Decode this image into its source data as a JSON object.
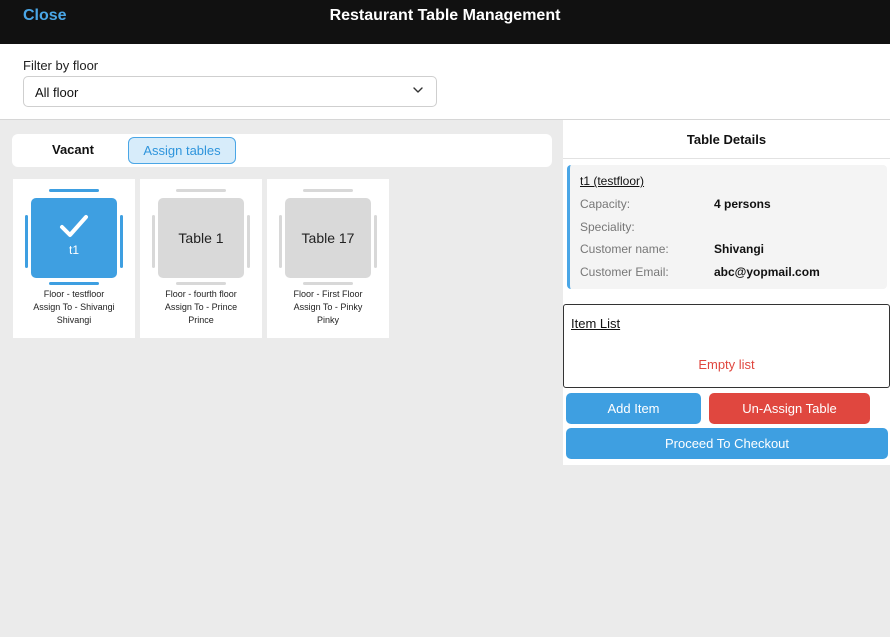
{
  "header": {
    "close_label": "Close",
    "title": "Restaurant Table Management"
  },
  "filter": {
    "label": "Filter by floor",
    "selected": "All floor"
  },
  "tabs": {
    "vacant": "Vacant",
    "assign": "Assign tables"
  },
  "tables": [
    {
      "name": "t1",
      "floor_line": "Floor - testfloor",
      "assign_line": "Assign To - Shivangi",
      "assignee_line": "Shivangi",
      "selected": true
    },
    {
      "name": "Table 1",
      "floor_line": "Floor - fourth floor",
      "assign_line": "Assign To - Prince",
      "assignee_line": "Prince",
      "selected": false
    },
    {
      "name": "Table 17",
      "floor_line": "Floor - First Floor",
      "assign_line": "Assign To - Pinky",
      "assignee_line": "Pinky",
      "selected": false
    }
  ],
  "details": {
    "title": "Table Details",
    "table_link": "t1 (testfloor)",
    "capacity_label": "Capacity:",
    "capacity_value": "4 persons",
    "speciality_label": "Speciality:",
    "speciality_value": "",
    "customer_name_label": "Customer name:",
    "customer_name_value": "Shivangi",
    "customer_email_label": "Customer Email:",
    "customer_email_value": "abc@yopmail.com"
  },
  "items": {
    "label": "Item List",
    "empty_text": "Empty list"
  },
  "actions": {
    "add_item": "Add Item",
    "unassign": "Un-Assign Table",
    "checkout": "Proceed To Checkout"
  },
  "colors": {
    "accent": "#3e9fe1",
    "danger": "#e0473f",
    "topbar": "#111111"
  }
}
